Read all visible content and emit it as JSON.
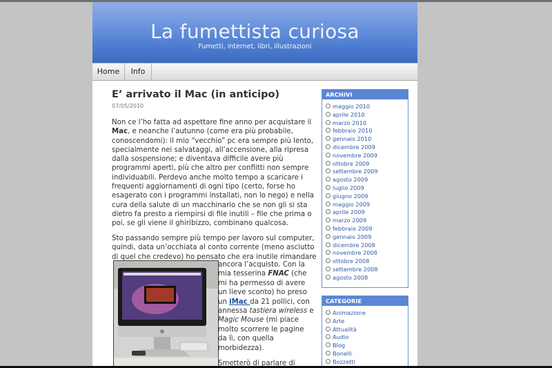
{
  "blog": {
    "title": "La fumettista curiosa",
    "tagline": "Fumetti, internet, libri, illustrazioni"
  },
  "nav": [
    {
      "label": "Home"
    },
    {
      "label": "Info"
    }
  ],
  "post": {
    "title": "E’ arrivato il Mac (in anticipo)",
    "date": "07/05/2010",
    "para1": {
      "l1": "Non ce l’ho fatta ad aspettare fine anno per acquistare il",
      "l2_bold": "Mac",
      "l2_rest": ", e neanche l’autunno (come era più probabile,",
      "l3": "conoscendomi): il mio “vecchio” pc era sempre più lento,",
      "l4": "specialmente nei salvataggi, all’accensione, alla ripresa",
      "l5": "dalla sospensione; e diventava difficile avere più",
      "l6": "programmi aperti, più che altro per conflitti non sempre",
      "l7": "individuabili. Perdevo anche molto tempo a scaricare i",
      "l8": "frequenti aggiornamenti di ogni tipo (certo, forse ho",
      "l9": "esagerato con i programmi installati, non lo nego) e nella",
      "l10": "cura della salute di un macchinario che se non gli si sta",
      "l11": "dietro fa presto a riempirsi di file inutili – file che prima o",
      "l12": "poi, se gli viene il ghiribizzo, combinano qualcosa."
    },
    "para2": {
      "l1": "Sto passando sempre più tempo per lavoro sul computer,",
      "l2": "quindi, data un’occhiata al conto corrente (meno asciutto",
      "l3": "di quel che credevo) ho pensato che era inutile rimandare"
    },
    "para3": {
      "l1": "ancora l’acquisto. Con la",
      "l2_pre": "mia tesserina ",
      "l2_em": "FNAC",
      "l2_post": " (che",
      "l3": "mi ha permesso di avere",
      "l4": "un lieve sconto) ho preso",
      "l5_pre": "un ",
      "l5_link": "iMac ",
      "l5_post": "da 21 pollici, con",
      "l6_pre": "annessa ",
      "l6_em": "tastiera wireless",
      "l6_post": " e",
      "l7_em": "Magic Mouse",
      "l7_post": " (mi piace",
      "l8": "molto scorrere le pagine",
      "l9": "da lì, con quella",
      "l10": "morbidezza).",
      "l11": "Smetterò di parlare di"
    }
  },
  "sidebar": {
    "archive": {
      "heading": "ARCHIVI",
      "items": [
        "maggio 2010",
        "aprile 2010",
        "marzo 2010",
        "febbraio 2010",
        "gennaio 2010",
        "dicembre 2009",
        "novembre 2009",
        "ottobre 2009",
        "settembre 2009",
        "agosto 2009",
        "luglio 2009",
        "giugno 2009",
        "maggio 2009",
        "aprile 2009",
        "marzo 2009",
        "febbraio 2009",
        "gennaio 2009",
        "dicembre 2008",
        "novembre 2008",
        "ottobre 2008",
        "settembre 2008",
        "agosto 2008"
      ]
    },
    "categories": {
      "heading": "CATEGORIE",
      "items": [
        "Animazione",
        "Arte",
        "Attualità",
        "Audio",
        "Blog",
        "Bonelli",
        "Bozzetti"
      ]
    }
  },
  "colors": {
    "header_top": "#8faee9",
    "header_bottom": "#3b6bc0",
    "sidebar_head": "#5b86d6",
    "link": "#2f5aa8"
  }
}
